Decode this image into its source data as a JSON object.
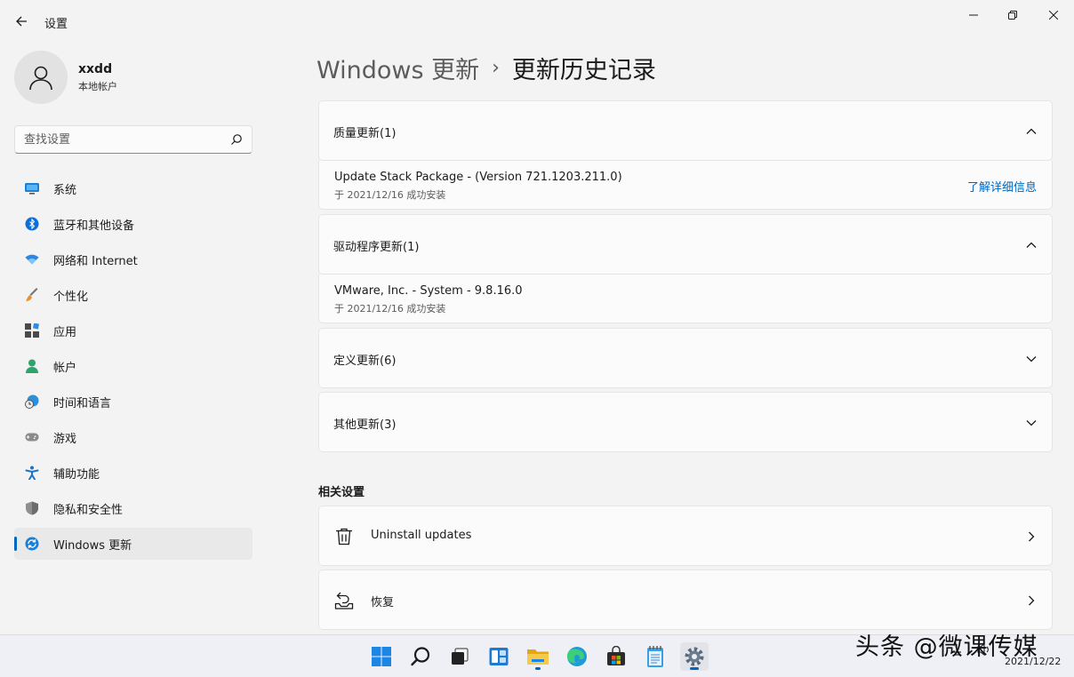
{
  "app": {
    "title": "设置"
  },
  "profile": {
    "name": "xxdd",
    "account_type": "本地帐户"
  },
  "search": {
    "placeholder": "查找设置"
  },
  "nav": {
    "items": [
      {
        "label": "系统",
        "icon": "monitor-icon"
      },
      {
        "label": "蓝牙和其他设备",
        "icon": "bluetooth-icon"
      },
      {
        "label": "网络和 Internet",
        "icon": "wifi-icon"
      },
      {
        "label": "个性化",
        "icon": "brush-icon"
      },
      {
        "label": "应用",
        "icon": "apps-icon"
      },
      {
        "label": "帐户",
        "icon": "person-icon"
      },
      {
        "label": "时间和语言",
        "icon": "globe-clock-icon"
      },
      {
        "label": "游戏",
        "icon": "gamepad-icon"
      },
      {
        "label": "辅助功能",
        "icon": "accessibility-icon"
      },
      {
        "label": "隐私和安全性",
        "icon": "shield-icon"
      },
      {
        "label": "Windows 更新",
        "icon": "windows-update-icon",
        "active": true
      }
    ]
  },
  "breadcrumb": {
    "parent": "Windows 更新",
    "separator": "›",
    "current": "更新历史记录"
  },
  "sections": [
    {
      "title": "质量更新(1)",
      "expanded": true,
      "entries": [
        {
          "name": "Update Stack Package - (Version 721.1203.211.0)",
          "status": "于 2021/12/16 成功安装",
          "link": "了解详细信息"
        }
      ]
    },
    {
      "title": "驱动程序更新(1)",
      "expanded": true,
      "entries": [
        {
          "name": "VMware, Inc. - System - 9.8.16.0",
          "status": "于 2021/12/16 成功安装"
        }
      ]
    },
    {
      "title": "定义更新(6)",
      "expanded": false
    },
    {
      "title": "其他更新(3)",
      "expanded": false
    }
  ],
  "related": {
    "title": "相关设置",
    "items": [
      {
        "label": "Uninstall updates",
        "icon": "trash-icon"
      },
      {
        "label": "恢复",
        "icon": "recovery-icon"
      }
    ]
  },
  "taskbar": {
    "watermark": "头条 @微课传媒",
    "date": "2021/12/22",
    "apps": [
      "start-icon",
      "search-icon",
      "task-view-icon",
      "widgets-icon",
      "file-explorer-icon",
      "edge-icon",
      "store-icon",
      "notepad-icon",
      "settings-icon"
    ]
  },
  "colors": {
    "accent": "#0067c0",
    "background": "#f3f3f3",
    "card": "#fbfbfb"
  }
}
